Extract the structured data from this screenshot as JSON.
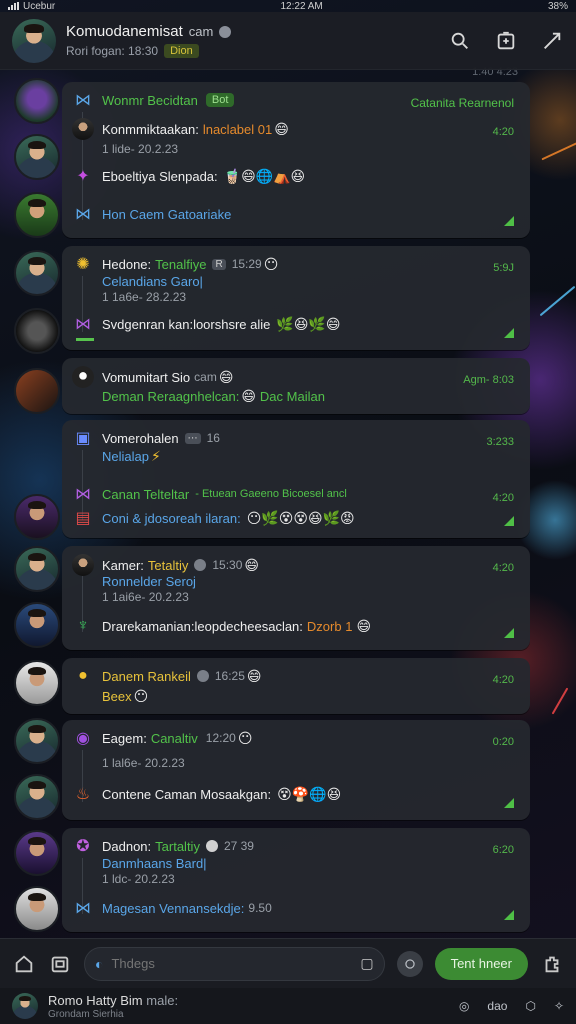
{
  "status": {
    "time": "12:22 AM",
    "carrier": "Ucebur",
    "battery": "38%"
  },
  "header": {
    "title": "Komuodanemisat",
    "title_suffix": "cam",
    "subtitle": "Rori fogan: 18:30",
    "tag": "Dion",
    "icons": [
      "search-icon",
      "edit-icon",
      "share-icon"
    ]
  },
  "top_timestamp": "1:40  4:23",
  "messages": [
    {
      "lines": [
        {
          "icon": "wing-icon",
          "text": "Wonmr Becidtan",
          "badge": "Bot",
          "right": "Catanita Rearnenol",
          "color": "green"
        },
        {
          "icon": "avatar",
          "text": "Konmmiktaakan:",
          "accent": "lnaclabel 01",
          "time": "4:20"
        },
        {
          "icon": "none",
          "text": "1 lide- 20.2.23",
          "dim": true
        },
        {
          "icon": "star-icon",
          "text": "Eboeltiya Slenpada:",
          "emoji": "🧋😄🌐⛺😆"
        },
        {
          "icon": "wing-icon",
          "text": "Hon Caem Gatoariake",
          "color": "blue"
        }
      ]
    },
    {
      "lines": [
        {
          "icon": "sun-icon",
          "text": "Hedone:",
          "accent": "Tenalfiye",
          "extra": "15:29",
          "time": "5:9J"
        },
        {
          "icon": "none",
          "text": "Celandians Garo|",
          "color": "blue"
        },
        {
          "icon": "none",
          "text": "1 1a6e- 28.2.23",
          "dim": true
        },
        {
          "icon": "wing-icon",
          "text": "Svdgenran kan:loorshsre alie",
          "emoji": "🌿😆🌿😄"
        }
      ]
    },
    {
      "lines": [
        {
          "icon": "avatar",
          "text": "Vomumitart Sio",
          "accent": "cam",
          "time": "Agm- 8:03"
        },
        {
          "icon": "none",
          "text": "Deman Reraagnhelcan:",
          "accent": "Dac Mailan"
        }
      ]
    },
    {
      "lines": [
        {
          "icon": "cube-icon",
          "text": "Vomerohalen",
          "extra": "16",
          "time": "3:233"
        },
        {
          "icon": "none",
          "text": "Nelialap",
          "color": "blue"
        },
        {
          "icon": "wing-icon",
          "text": "Canan Telteltar",
          "sub": "- Etuean Gaeeno Bicoesel ancl",
          "time": "4:20"
        },
        {
          "icon": "bag-icon",
          "text": "Coni & jdosoreah ilaran:",
          "emoji": "😶🌿😵😵😆🌿😡"
        }
      ]
    },
    {
      "lines": [
        {
          "icon": "avatar",
          "text": "Kamer:",
          "accent": "Tetaltiy",
          "extra": "15:30",
          "time": "4:20"
        },
        {
          "icon": "none",
          "text": "Ronnelder Seroj",
          "color": "blue"
        },
        {
          "icon": "none",
          "text": "1 1ai6e- 20.2.23",
          "dim": true
        },
        {
          "icon": "cup-icon",
          "text": "Drarekamanian:leopdecheesaclan:",
          "accent": "Dzorb 1",
          "emoji": "😄"
        }
      ]
    },
    {
      "lines": [
        {
          "icon": "smile-icon",
          "text": "Danem Rankeil",
          "extra": "16:25",
          "time": "4:20",
          "color": "yellow"
        },
        {
          "icon": "none",
          "text": "Beex",
          "color": "yellow"
        }
      ]
    },
    {
      "lines": [
        {
          "icon": "orb-icon",
          "text": "Eagem:",
          "accent": "Canaltiv",
          "extra": "12:20",
          "time": "0:20"
        },
        {
          "icon": "none",
          "text": "1 lal6e- 20.2.23",
          "dim": true
        },
        {
          "icon": "flame-icon",
          "text": "Contene Caman Mosaakgan:",
          "emoji": "😵🍄🌐😆"
        }
      ]
    },
    {
      "lines": [
        {
          "icon": "ring-icon",
          "text": "Dadnon:",
          "accent": "Tartaltiy",
          "extra": "27 39",
          "time": "6:20"
        },
        {
          "icon": "none",
          "text": "Danmhaans Bard|",
          "color": "blue"
        },
        {
          "icon": "none",
          "text": "1 ldc- 20.2.23",
          "dim": true
        },
        {
          "icon": "wing-icon",
          "text": "Magesan Vennansekdje:",
          "accent": "9.50",
          "color": "blue"
        }
      ]
    }
  ],
  "composer": {
    "placeholder": "Thdegs",
    "send_label": "Tent hneer"
  },
  "bottombar": {
    "title": "Romo Hatty Bim",
    "title_suffix": "male:",
    "subtitle": "Grondam Sierhia",
    "right_label": "dao"
  }
}
